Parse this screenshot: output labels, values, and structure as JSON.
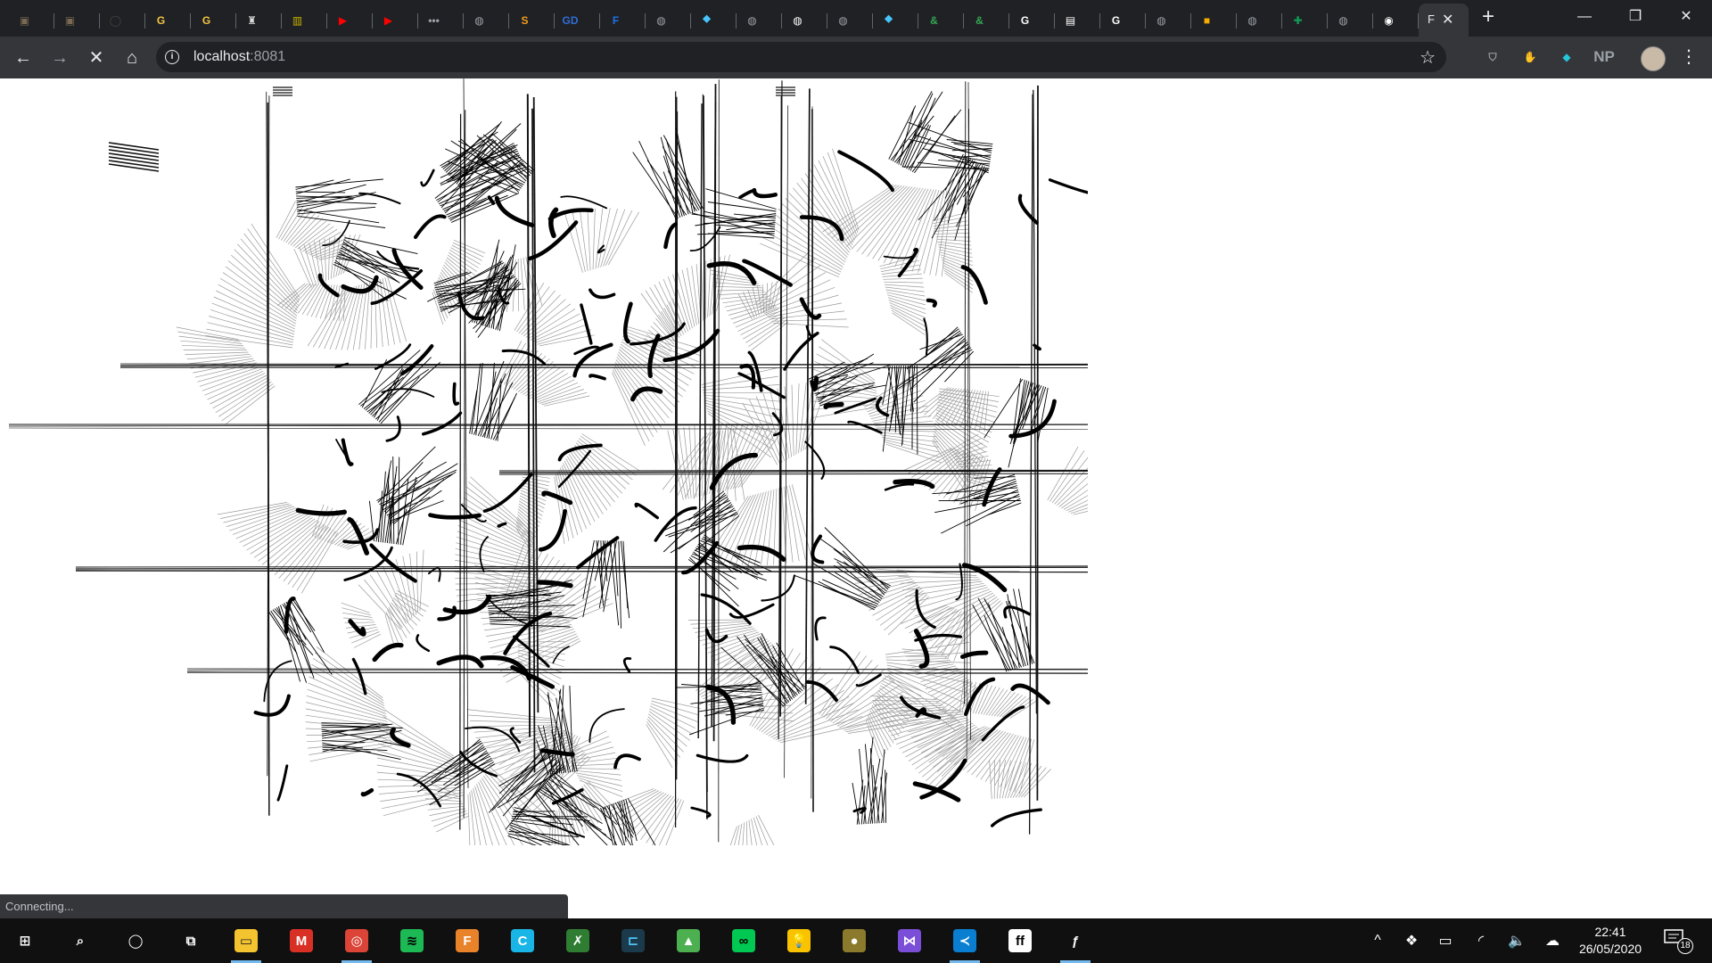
{
  "browser": {
    "tabs": [
      {
        "icon": "image-icon",
        "color": "#7a6a55",
        "glyph": "▣"
      },
      {
        "icon": "image-icon",
        "color": "#7a6a55",
        "glyph": "▣"
      },
      {
        "icon": "circle-logo-icon",
        "color": "#444444",
        "glyph": "◯"
      },
      {
        "icon": "goodreads-icon",
        "color": "#f4c542",
        "glyph": "G"
      },
      {
        "icon": "goodreads-icon",
        "color": "#f4c542",
        "glyph": "G"
      },
      {
        "icon": "crest-icon",
        "color": "#dddddd",
        "glyph": "♜"
      },
      {
        "icon": "imdb-icon",
        "color": "#c8b400",
        "glyph": "▥"
      },
      {
        "icon": "youtube-icon",
        "color": "#ff0000",
        "glyph": "▶"
      },
      {
        "icon": "youtube-icon",
        "color": "#ff0000",
        "glyph": "▶"
      },
      {
        "icon": "dots-icon",
        "color": "#9aa0a6",
        "glyph": "•••"
      },
      {
        "icon": "globe-icon",
        "color": "#9aa0a6",
        "glyph": "◍"
      },
      {
        "icon": "s-logo-icon",
        "color": "#f29a1f",
        "glyph": "S"
      },
      {
        "icon": "gd-icon",
        "color": "#2f6fd6",
        "glyph": "GD"
      },
      {
        "icon": "f-circle-icon",
        "color": "#1a73e8",
        "glyph": "F"
      },
      {
        "icon": "globe-icon",
        "color": "#9aa0a6",
        "glyph": "◍"
      },
      {
        "icon": "flutter-icon",
        "color": "#47c5fb",
        "glyph": "⯁"
      },
      {
        "icon": "globe-icon",
        "color": "#9aa0a6",
        "glyph": "◍"
      },
      {
        "icon": "white-globe-icon",
        "color": "#ffffff",
        "glyph": "◍"
      },
      {
        "icon": "globe-icon",
        "color": "#9aa0a6",
        "glyph": "◍"
      },
      {
        "icon": "flutter-icon",
        "color": "#47c5fb",
        "glyph": "⯁"
      },
      {
        "icon": "ampersand-icon",
        "color": "#34a853",
        "glyph": "&"
      },
      {
        "icon": "ampersand-icon",
        "color": "#34a853",
        "glyph": "&"
      },
      {
        "icon": "google-icon",
        "color": "#ffffff",
        "glyph": "G"
      },
      {
        "icon": "save-disk-icon",
        "color": "#ffffff",
        "glyph": "▤"
      },
      {
        "icon": "google-icon",
        "color": "#ffffff",
        "glyph": "G"
      },
      {
        "icon": "globe-icon",
        "color": "#9aa0a6",
        "glyph": "◍"
      },
      {
        "icon": "slides-icon",
        "color": "#f9ab00",
        "glyph": "■"
      },
      {
        "icon": "globe-icon",
        "color": "#9aa0a6",
        "glyph": "◍"
      },
      {
        "icon": "sheets-icon",
        "color": "#0f9d58",
        "glyph": "✚"
      },
      {
        "icon": "globe-icon",
        "color": "#9aa0a6",
        "glyph": "◍"
      },
      {
        "icon": "github-icon",
        "color": "#ffffff",
        "glyph": "◉"
      }
    ],
    "active_tab": {
      "title": "F",
      "close": "✕"
    },
    "new_tab": "+",
    "window_controls": {
      "minimize": "—",
      "restore": "❐",
      "close": "✕"
    },
    "nav": {
      "back": "←",
      "forward": "→",
      "stop": "✕",
      "home": "⌂"
    },
    "address": {
      "host": "localhost",
      "port": ":8081",
      "info": "i",
      "star": "☆"
    },
    "extensions": [
      {
        "icon": "shield-extension-icon",
        "color": "#9aa0a6",
        "glyph": "⛉"
      },
      {
        "icon": "hand-extension-icon",
        "color": "#e53935",
        "glyph": "✋"
      },
      {
        "icon": "gem-extension-icon",
        "color": "#26c6da",
        "glyph": "◆"
      },
      {
        "icon": "np-extension-icon",
        "color": "#9aa0a6",
        "glyph": "NP"
      }
    ],
    "menu": "⋮",
    "status": "Connecting..."
  },
  "taskbar": {
    "apps": [
      {
        "icon": "windows-start-icon",
        "color": "#ffffff",
        "bg": "transparent",
        "glyph": "⊞",
        "active": false
      },
      {
        "icon": "search-icon",
        "color": "#ffffff",
        "bg": "transparent",
        "glyph": "⌕",
        "active": false
      },
      {
        "icon": "cortana-icon",
        "color": "#ffffff",
        "bg": "transparent",
        "glyph": "◯",
        "active": false
      },
      {
        "icon": "task-view-icon",
        "color": "#ffffff",
        "bg": "transparent",
        "glyph": "⧉",
        "active": false
      },
      {
        "icon": "file-explorer-icon",
        "color": "#1e1e1e",
        "bg": "#f4c430",
        "glyph": "▭",
        "active": true
      },
      {
        "icon": "gmail-icon",
        "color": "#ffffff",
        "bg": "#d93025",
        "glyph": "M",
        "active": false
      },
      {
        "icon": "chrome-icon",
        "color": "#ffffff",
        "bg": "#db4437",
        "glyph": "◎",
        "active": true
      },
      {
        "icon": "spotify-icon",
        "color": "#000000",
        "bg": "#1db954",
        "glyph": "≋",
        "active": false
      },
      {
        "icon": "f-app-icon",
        "color": "#ffffff",
        "bg": "#e8832a",
        "glyph": "F",
        "active": false
      },
      {
        "icon": "c-app-icon",
        "color": "#ffffff",
        "bg": "#19b5e6",
        "glyph": "C",
        "active": false
      },
      {
        "icon": "x-app-icon",
        "color": "#ffffff",
        "bg": "#2e7d32",
        "glyph": "✗",
        "active": false
      },
      {
        "icon": "terminal-app-icon",
        "color": "#4fc3f7",
        "bg": "#1b3a4b",
        "glyph": "⊏",
        "active": false
      },
      {
        "icon": "image-app-icon",
        "color": "#ffffff",
        "bg": "#4caf50",
        "glyph": "▲",
        "active": false
      },
      {
        "icon": "infinity-app-icon",
        "color": "#000000",
        "bg": "#00c853",
        "glyph": "∞",
        "active": false
      },
      {
        "icon": "bulb-app-icon",
        "color": "#ffffff",
        "bg": "#f9c300",
        "glyph": "💡",
        "active": false
      },
      {
        "icon": "globe-app-icon",
        "color": "#ffffff",
        "bg": "#8b7a2b",
        "glyph": "●",
        "active": false
      },
      {
        "icon": "visual-studio-icon",
        "color": "#ffffff",
        "bg": "#7b4ed8",
        "glyph": "⋈",
        "active": false
      },
      {
        "icon": "vscode-icon",
        "color": "#ffffff",
        "bg": "#0a7fd1",
        "glyph": "≺",
        "active": true
      },
      {
        "icon": "ff-app-icon",
        "color": "#000000",
        "bg": "#ffffff",
        "glyph": "ff",
        "active": false
      },
      {
        "icon": "script-f-app-icon",
        "color": "#ffffff",
        "bg": "transparent",
        "glyph": "ƒ",
        "active": true
      }
    ],
    "tray": [
      {
        "icon": "chevron-up-icon",
        "glyph": "^"
      },
      {
        "icon": "dropbox-icon",
        "glyph": "❖"
      },
      {
        "icon": "battery-icon",
        "glyph": "▭"
      },
      {
        "icon": "wifi-icon",
        "glyph": "◜"
      },
      {
        "icon": "volume-icon",
        "glyph": "🔈"
      },
      {
        "icon": "cloud-icon",
        "glyph": "☁"
      }
    ],
    "clock": {
      "time": "22:41",
      "date": "26/05/2020"
    },
    "notifications": {
      "icon": "notification-icon",
      "count": "18"
    }
  }
}
